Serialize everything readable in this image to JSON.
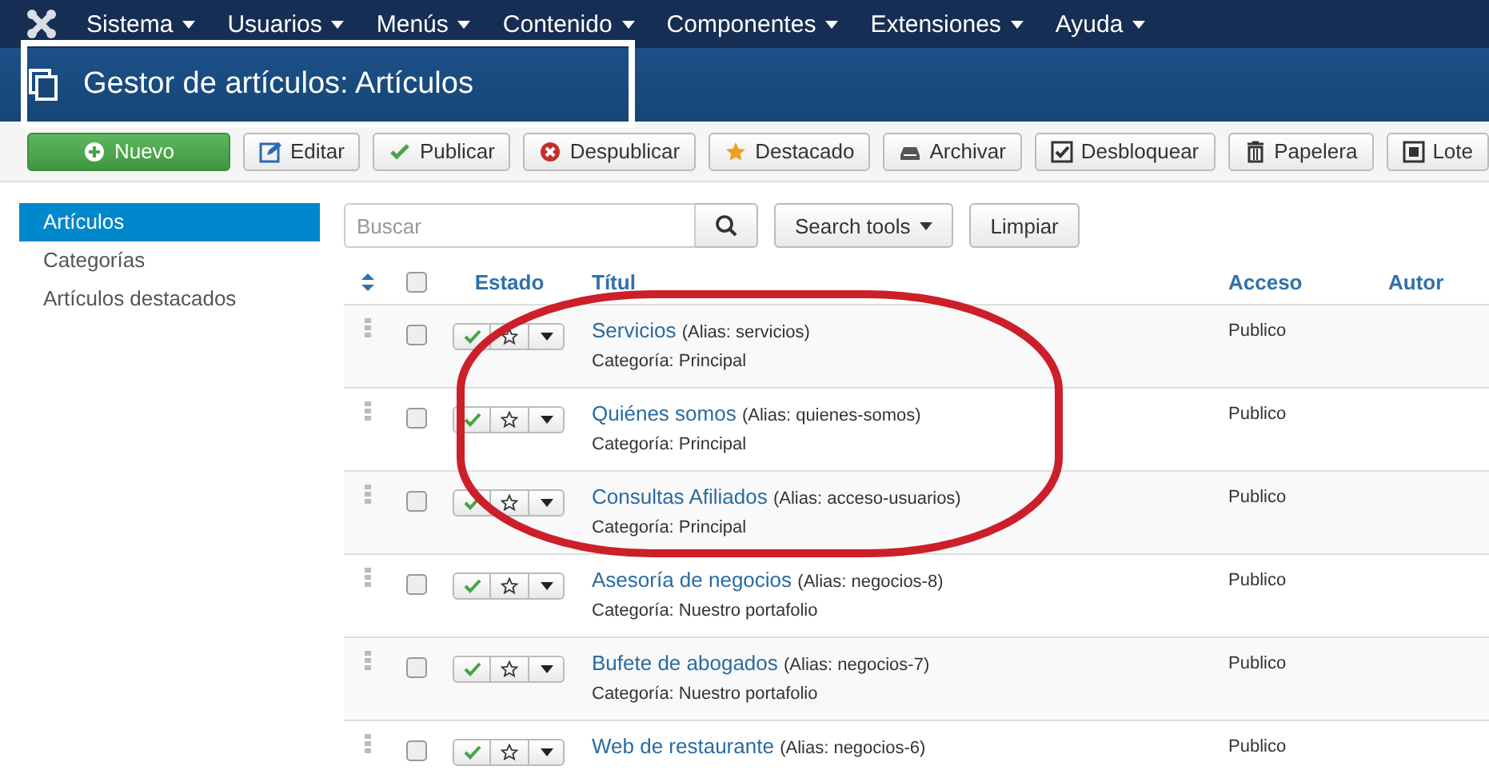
{
  "navbar": {
    "menus": [
      "Sistema",
      "Usuarios",
      "Menús",
      "Contenido",
      "Componentes",
      "Extensiones",
      "Ayuda"
    ]
  },
  "title_bar": {
    "title": "Gestor de artículos: Artículos"
  },
  "toolbar": {
    "buttons": [
      {
        "label": "Nuevo",
        "kind": "primary"
      },
      {
        "label": "Editar",
        "kind": "default"
      },
      {
        "label": "Publicar",
        "kind": "default"
      },
      {
        "label": "Despublicar",
        "kind": "default"
      },
      {
        "label": "Destacado",
        "kind": "default"
      },
      {
        "label": "Archivar",
        "kind": "default"
      },
      {
        "label": "Desbloquear",
        "kind": "default"
      },
      {
        "label": "Papelera",
        "kind": "default"
      },
      {
        "label": "Lote",
        "kind": "default"
      }
    ]
  },
  "sidebar": {
    "items": [
      {
        "label": "Artículos",
        "selected": true
      },
      {
        "label": "Categorías",
        "selected": false
      },
      {
        "label": "Artículos destacados",
        "selected": false
      }
    ]
  },
  "filters": {
    "search": {
      "placeholder": "Buscar"
    },
    "search_tools": "Search tools",
    "clear": "Limpiar"
  },
  "table": {
    "select_all": {
      "checked": false
    },
    "columns": [
      "Estado",
      "Títul",
      "Acceso",
      "Autor"
    ],
    "rows": [
      {
        "title": "Servicios",
        "alias": "(Alias: servicios)",
        "category": "Categoría: Principal",
        "access": "Publico",
        "checked": false,
        "published": true,
        "featured": false
      },
      {
        "title": "Quiénes somos",
        "alias": "(Alias: quienes-somos)",
        "category": "Categoría: Principal",
        "access": "Publico",
        "checked": false,
        "published": true,
        "featured": false
      },
      {
        "title": "Consultas Afiliados",
        "alias": "(Alias: acceso-usuarios)",
        "category": "Categoría: Principal",
        "access": "Publico",
        "checked": false,
        "published": true,
        "featured": false
      },
      {
        "title": "Asesoría de negocios",
        "alias": "(Alias: negocios-8)",
        "category": "Categoría: Nuestro portafolio",
        "access": "Publico",
        "checked": false,
        "published": true,
        "featured": false
      },
      {
        "title": "Bufete de abogados",
        "alias": "(Alias: negocios-7)",
        "category": "Categoría: Nuestro portafolio",
        "access": "Publico",
        "checked": false,
        "published": true,
        "featured": false
      },
      {
        "title": "Web de restaurante",
        "alias": "(Alias: negocios-6)",
        "access": "Publico",
        "checked": false,
        "published": true,
        "featured": false
      }
    ]
  }
}
